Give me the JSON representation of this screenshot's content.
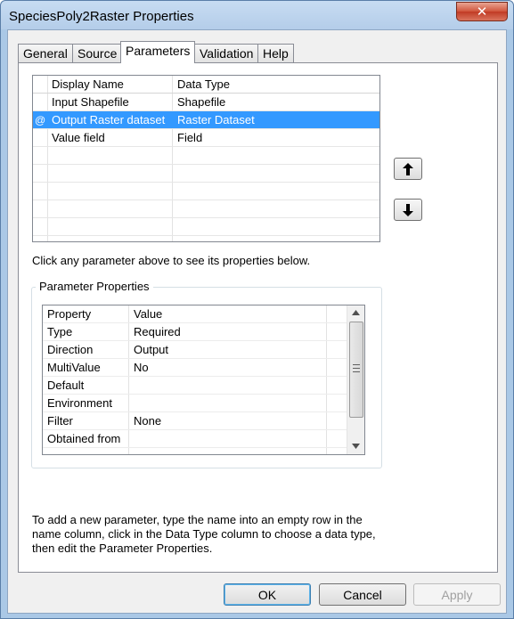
{
  "window": {
    "title": "SpeciesPoly2Raster Properties",
    "close_glyph": "✕"
  },
  "tabs": [
    {
      "label": "General"
    },
    {
      "label": "Source"
    },
    {
      "label": "Parameters",
      "active": true
    },
    {
      "label": "Validation"
    },
    {
      "label": "Help"
    }
  ],
  "parameters": {
    "columns": [
      "Display Name",
      "Data Type"
    ],
    "rows": [
      {
        "name": "Input Shapefile",
        "type": "Shapefile"
      },
      {
        "name": "Output Raster dataset",
        "type": "Raster Dataset",
        "selected": true,
        "marker": "@"
      },
      {
        "name": "Value field",
        "type": "Field"
      }
    ],
    "move_up_icon": "arrow-up-icon",
    "move_down_icon": "arrow-down-icon"
  },
  "hint_text": "Click any parameter above to see its properties below.",
  "properties": {
    "group_label": "Parameter Properties",
    "columns": [
      "Property",
      "Value"
    ],
    "rows": [
      {
        "property": "Type",
        "value": "Required"
      },
      {
        "property": "Direction",
        "value": "Output"
      },
      {
        "property": "MultiValue",
        "value": "No"
      },
      {
        "property": "Default",
        "value": ""
      },
      {
        "property": "Environment",
        "value": ""
      },
      {
        "property": "Filter",
        "value": "None"
      },
      {
        "property": "Obtained from",
        "value": ""
      }
    ]
  },
  "footnote": "To add a new parameter, type the name into an empty row in the name column, click in the Data Type column to choose a data type, then edit the Parameter Properties.",
  "buttons": {
    "ok": "OK",
    "cancel": "Cancel",
    "apply": "Apply"
  },
  "colors": {
    "selection": "#3399ff",
    "frame": "#aac8e6",
    "close": "#c13a24"
  }
}
